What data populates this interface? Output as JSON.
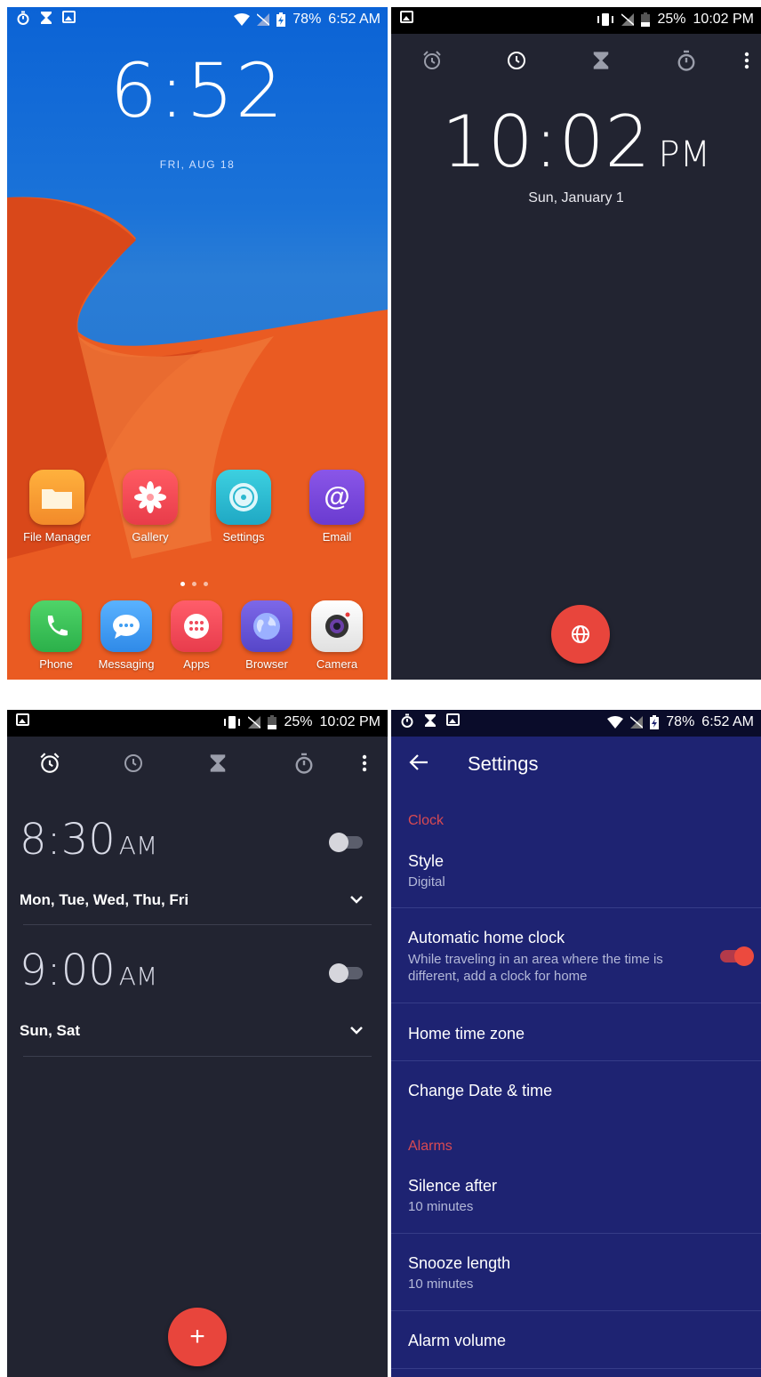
{
  "panel1": {
    "status": {
      "battery": "78%",
      "time": "6:52 AM"
    },
    "lock_time": "6:52",
    "lock_date": "FRI, AUG 18",
    "apps_row1": [
      {
        "label": "File Manager",
        "icon": "folder-icon",
        "color": "#f2a13a"
      },
      {
        "label": "Gallery",
        "icon": "flower-icon",
        "color": "#f04a53"
      },
      {
        "label": "Settings",
        "icon": "settings-ring-icon",
        "color": "#2bb8cf"
      },
      {
        "label": "Email",
        "icon": "at-sign-icon",
        "color": "#7a47d6"
      }
    ],
    "dock": [
      {
        "label": "Phone",
        "icon": "phone-icon",
        "color": "#3cc15a"
      },
      {
        "label": "Messaging",
        "icon": "chat-bubble-icon",
        "color": "#3f9df2"
      },
      {
        "label": "Apps",
        "icon": "app-grid-icon",
        "color": "#f04a5a"
      },
      {
        "label": "Browser",
        "icon": "globe-icon",
        "color": "#6a58d6"
      },
      {
        "label": "Camera",
        "icon": "camera-icon",
        "color": "#f0f0f0"
      }
    ]
  },
  "panel2": {
    "status": {
      "battery": "25%",
      "time": "10:02 PM"
    },
    "time": "10:02",
    "ampm": "PM",
    "date": "Sun, January 1"
  },
  "panel3": {
    "status": {
      "battery": "25%",
      "time": "10:02 PM"
    },
    "alarms": [
      {
        "time": "8:30",
        "ampm": "AM",
        "days": "Mon, Tue, Wed, Thu, Fri",
        "enabled": false
      },
      {
        "time": "9:00",
        "ampm": "AM",
        "days": "Sun, Sat",
        "enabled": false
      }
    ],
    "fab": "+"
  },
  "panel4": {
    "status": {
      "battery": "78%",
      "time": "6:52 AM"
    },
    "title": "Settings",
    "section_clock": "Clock",
    "style": {
      "title": "Style",
      "value": "Digital"
    },
    "auto_home": {
      "title": "Automatic home clock",
      "desc": "While traveling in an area where the time is different, add a clock for home",
      "enabled": true
    },
    "home_tz": "Home time zone",
    "change_dt": "Change Date & time",
    "section_alarms": "Alarms",
    "silence": {
      "title": "Silence after",
      "value": "10 minutes"
    },
    "snooze": {
      "title": "Snooze length",
      "value": "10 minutes"
    },
    "volume": "Alarm volume"
  },
  "colors": {
    "accent_red": "#e8453c",
    "clock_bg": "#222431",
    "settings_bg": "#1e2372",
    "section_red": "#d94a52"
  }
}
